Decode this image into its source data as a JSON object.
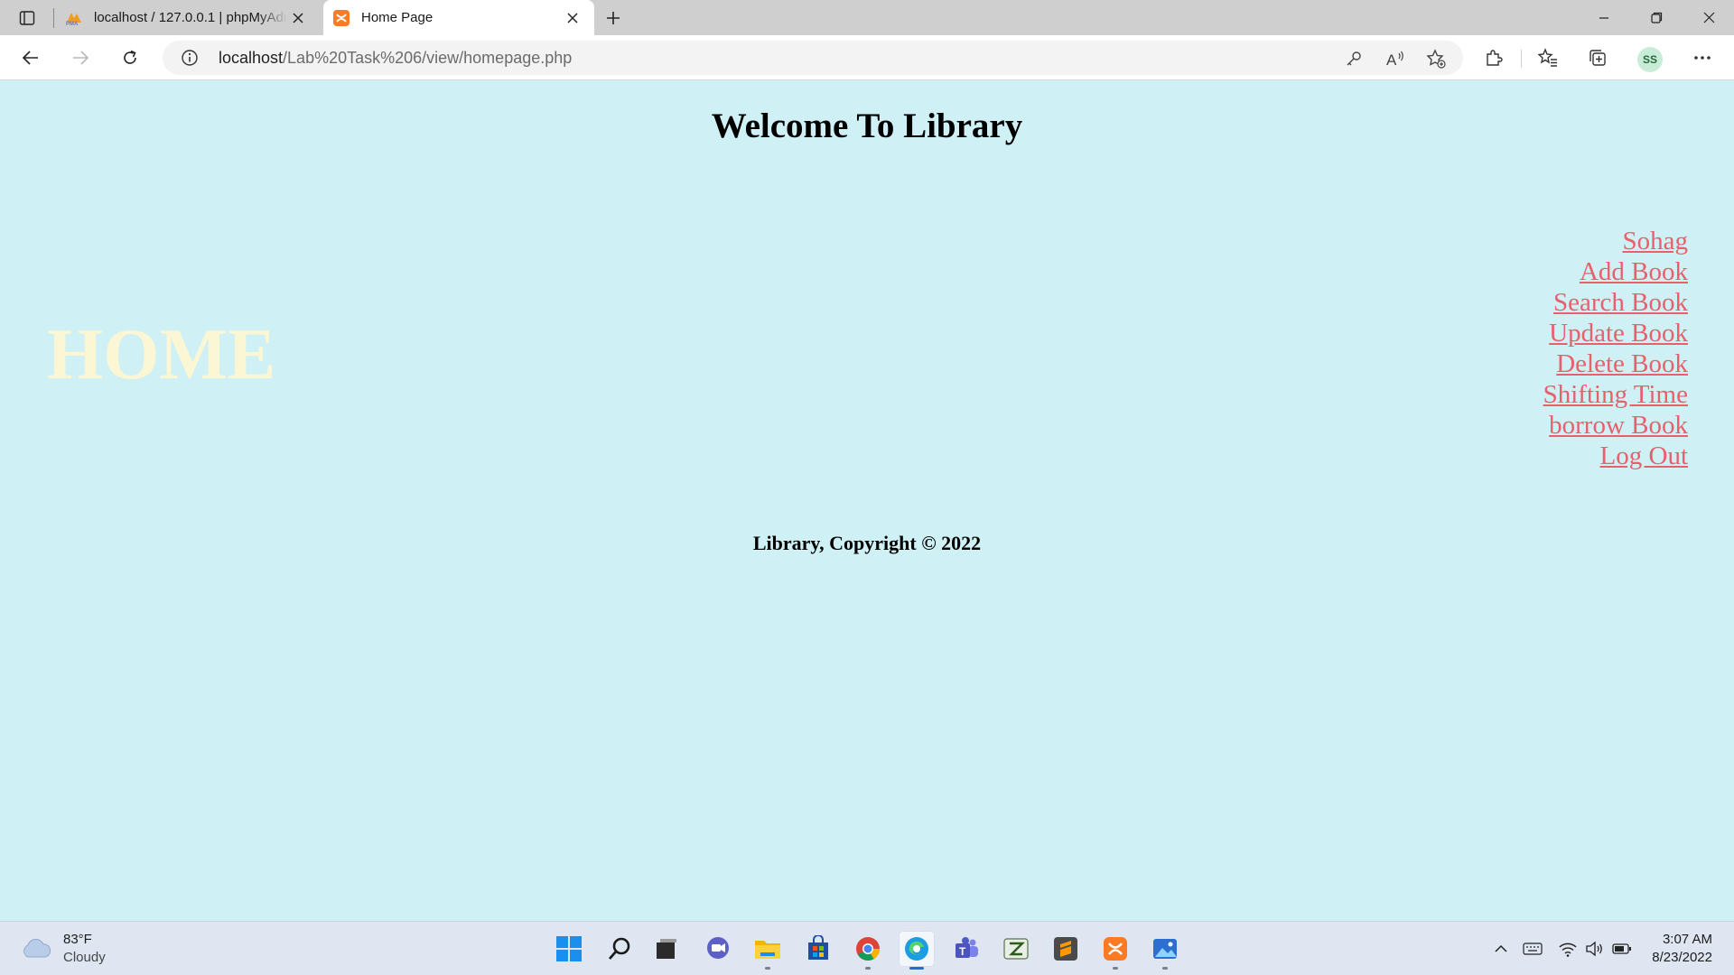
{
  "browser": {
    "tabs": [
      {
        "title": "localhost / 127.0.0.1 | phpMyAdmin",
        "active": false,
        "favicon": "phpmyadmin-icon"
      },
      {
        "title": "Home Page",
        "active": true,
        "favicon": "xampp-icon"
      }
    ],
    "address": {
      "host": "localhost",
      "path": "/Lab%20Task%206/view/homepage.php"
    },
    "profile_initials": "SS"
  },
  "page": {
    "heading": "Welcome To Library",
    "home_label": "HOME",
    "nav_links": [
      "Sohag",
      "Add Book",
      "Search Book",
      "Update Book",
      "Delete Book",
      "Shifting Time",
      "borrow Book",
      "Log Out"
    ],
    "footer": "Library, Copyright © 2022"
  },
  "colors": {
    "page_background": "#cff0f5",
    "link": "#e8606c",
    "home_label": "#fbf6d3"
  },
  "taskbar": {
    "weather": {
      "temp": "83°F",
      "condition": "Cloudy"
    },
    "apps": [
      "start-icon",
      "search-icon",
      "task-view-icon",
      "chat-icon",
      "file-explorer-icon",
      "store-icon",
      "chrome-icon",
      "edge-icon",
      "teams-icon",
      "excel-tool-icon",
      "sublime-text-icon",
      "xampp-icon",
      "photos-icon"
    ],
    "clock": {
      "time": "3:07 AM",
      "date": "8/23/2022"
    }
  }
}
